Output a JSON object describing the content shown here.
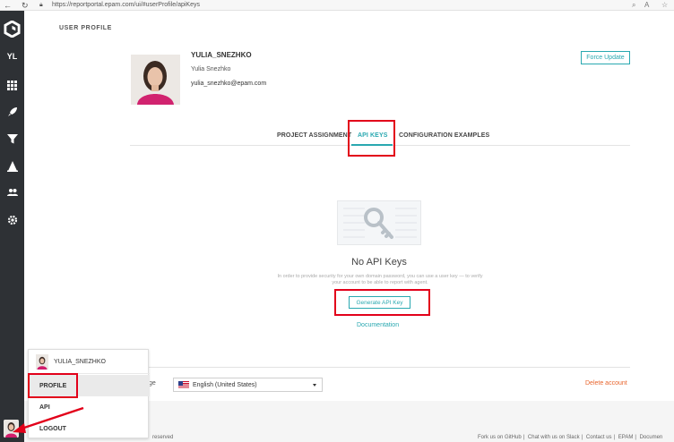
{
  "browser": {
    "url": "https://reportportal.epam.com/ui/#userProfile/apiKeys"
  },
  "sidebar": {
    "project_initials": "YL"
  },
  "page": {
    "title": "USER PROFILE"
  },
  "profile": {
    "username": "YULIA_SNEZHKO",
    "full_name": "Yulia Snezhko",
    "email": "yulia_snezhko@epam.com",
    "force_update_label": "Force Update"
  },
  "tabs": [
    {
      "label": "PROJECT ASSIGNMENT"
    },
    {
      "label": "API KEYS"
    },
    {
      "label": "CONFIGURATION EXAMPLES"
    }
  ],
  "api_keys": {
    "empty_title": "No API Keys",
    "description": "In order to provide security for your own domain password, you can use a user key — to verify your account to be able to report with agent.",
    "generate_label": "Generate API Key",
    "documentation_label": "Documentation"
  },
  "settings": {
    "language_label": "ge",
    "language_value": "English (United States)",
    "delete_label": "Delete account"
  },
  "footer": {
    "left": "reserved",
    "links": [
      "Fork us on GitHub",
      "Chat with us on Slack",
      "Contact us",
      "EPAM",
      "Documen"
    ]
  },
  "user_menu": {
    "username": "YULIA_SNEZHKO",
    "items": [
      {
        "label": "PROFILE"
      },
      {
        "label": "API"
      },
      {
        "label": "LOGOUT"
      }
    ]
  },
  "colors": {
    "accent": "#29a8b0",
    "sidebar": "#2e3135",
    "highlight": "#e2001a",
    "danger": "#e8642c"
  }
}
